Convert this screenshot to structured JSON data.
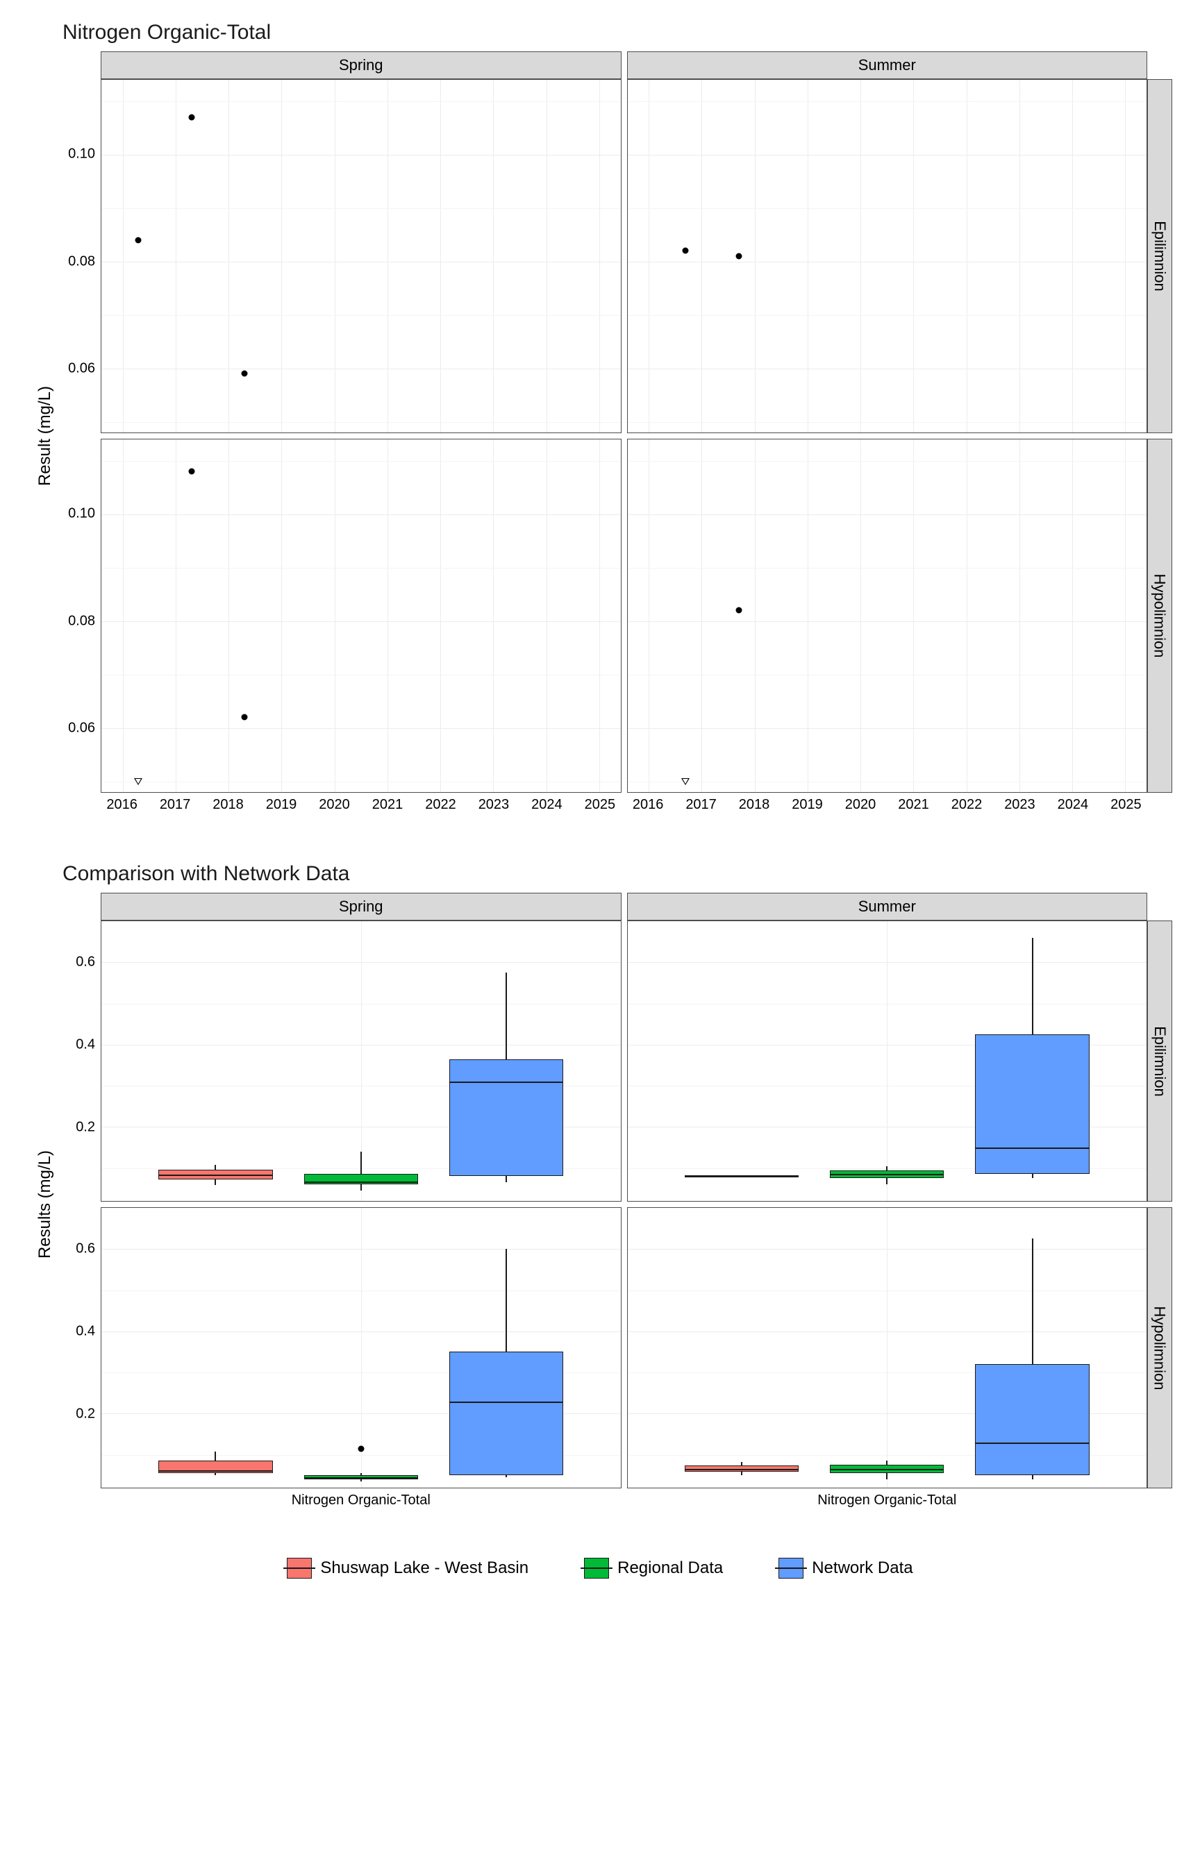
{
  "chart_data": [
    {
      "type": "scatter",
      "title": "Nitrogen Organic-Total",
      "ylabel": "Result (mg/L)",
      "x_ticks": [
        2016,
        2017,
        2018,
        2019,
        2020,
        2021,
        2022,
        2023,
        2024,
        2025
      ],
      "y_ticks": [
        0.06,
        0.08,
        0.1
      ],
      "ylim": [
        0.048,
        0.114
      ],
      "facets_col": [
        "Spring",
        "Summer"
      ],
      "facets_row": [
        "Epilimnion",
        "Hypolimnion"
      ],
      "series": [
        {
          "name": "measured",
          "marker": "point",
          "data": {
            "Spring|Epilimnion": [
              {
                "x": 2016.3,
                "y": 0.084
              },
              {
                "x": 2017.3,
                "y": 0.107
              },
              {
                "x": 2018.3,
                "y": 0.059
              }
            ],
            "Summer|Epilimnion": [
              {
                "x": 2016.7,
                "y": 0.082
              },
              {
                "x": 2017.7,
                "y": 0.081
              }
            ],
            "Spring|Hypolimnion": [
              {
                "x": 2017.3,
                "y": 0.108
              },
              {
                "x": 2018.3,
                "y": 0.062
              }
            ],
            "Summer|Hypolimnion": [
              {
                "x": 2017.7,
                "y": 0.082
              }
            ]
          }
        },
        {
          "name": "below-detection",
          "marker": "triangle-open-down",
          "data": {
            "Spring|Hypolimnion": [
              {
                "x": 2016.3,
                "y": 0.05
              }
            ],
            "Summer|Hypolimnion": [
              {
                "x": 2016.7,
                "y": 0.05
              }
            ]
          }
        }
      ]
    },
    {
      "type": "boxplot",
      "title": "Comparison with Network Data",
      "ylabel": "Results (mg/L)",
      "xlabel": "Nitrogen Organic-Total",
      "y_ticks": [
        0.2,
        0.4,
        0.6
      ],
      "ylim": [
        0.02,
        0.7
      ],
      "facets_col": [
        "Spring",
        "Summer"
      ],
      "facets_row": [
        "Epilimnion",
        "Hypolimnion"
      ],
      "categories": [
        "Shuswap Lake - West Basin",
        "Regional Data",
        "Network Data"
      ],
      "colors": {
        "Shuswap Lake - West Basin": "#F8766D",
        "Regional Data": "#00BA38",
        "Network Data": "#619CFF"
      },
      "boxes": {
        "Spring|Epilimnion": [
          {
            "cat": "Shuswap Lake - West Basin",
            "min": 0.059,
            "q1": 0.072,
            "med": 0.084,
            "q3": 0.096,
            "max": 0.107
          },
          {
            "cat": "Regional Data",
            "min": 0.045,
            "q1": 0.06,
            "med": 0.068,
            "q3": 0.085,
            "max": 0.14
          },
          {
            "cat": "Network Data",
            "min": 0.065,
            "q1": 0.08,
            "med": 0.31,
            "q3": 0.365,
            "max": 0.575
          }
        ],
        "Summer|Epilimnion": [
          {
            "cat": "Shuswap Lake - West Basin",
            "min": 0.081,
            "q1": 0.081,
            "med": 0.0815,
            "q3": 0.082,
            "max": 0.082
          },
          {
            "cat": "Regional Data",
            "min": 0.06,
            "q1": 0.075,
            "med": 0.085,
            "q3": 0.095,
            "max": 0.105
          },
          {
            "cat": "Network Data",
            "min": 0.075,
            "q1": 0.085,
            "med": 0.15,
            "q3": 0.425,
            "max": 0.66
          }
        ],
        "Spring|Hypolimnion": [
          {
            "cat": "Shuswap Lake - West Basin",
            "min": 0.05,
            "q1": 0.056,
            "med": 0.062,
            "q3": 0.085,
            "max": 0.108
          },
          {
            "cat": "Regional Data",
            "min": 0.035,
            "q1": 0.04,
            "med": 0.045,
            "q3": 0.05,
            "max": 0.055,
            "outliers": [
              0.115
            ]
          },
          {
            "cat": "Network Data",
            "min": 0.045,
            "q1": 0.05,
            "med": 0.23,
            "q3": 0.35,
            "max": 0.6
          }
        ],
        "Summer|Hypolimnion": [
          {
            "cat": "Shuswap Lake - West Basin",
            "min": 0.05,
            "q1": 0.058,
            "med": 0.066,
            "q3": 0.074,
            "max": 0.082
          },
          {
            "cat": "Regional Data",
            "min": 0.04,
            "q1": 0.055,
            "med": 0.065,
            "q3": 0.075,
            "max": 0.085
          },
          {
            "cat": "Network Data",
            "min": 0.04,
            "q1": 0.05,
            "med": 0.13,
            "q3": 0.32,
            "max": 0.625
          }
        ]
      }
    }
  ],
  "titles": {
    "fig1": "Nitrogen Organic-Total",
    "fig2": "Comparison with Network Data"
  },
  "axis": {
    "y1": "Result (mg/L)",
    "y2": "Results (mg/L)",
    "x2": "Nitrogen Organic-Total"
  },
  "strips": {
    "spring": "Spring",
    "summer": "Summer",
    "epi": "Epilimnion",
    "hypo": "Hypolimnion"
  },
  "yticks1": {
    "a": "0.06",
    "b": "0.08",
    "c": "0.10"
  },
  "yticks2": {
    "a": "0.2",
    "b": "0.4",
    "c": "0.6"
  },
  "xticks1": [
    "2016",
    "2017",
    "2018",
    "2019",
    "2020",
    "2021",
    "2022",
    "2023",
    "2024",
    "2025"
  ],
  "legend": {
    "a": "Shuswap Lake - West Basin",
    "b": "Regional Data",
    "c": "Network Data"
  }
}
